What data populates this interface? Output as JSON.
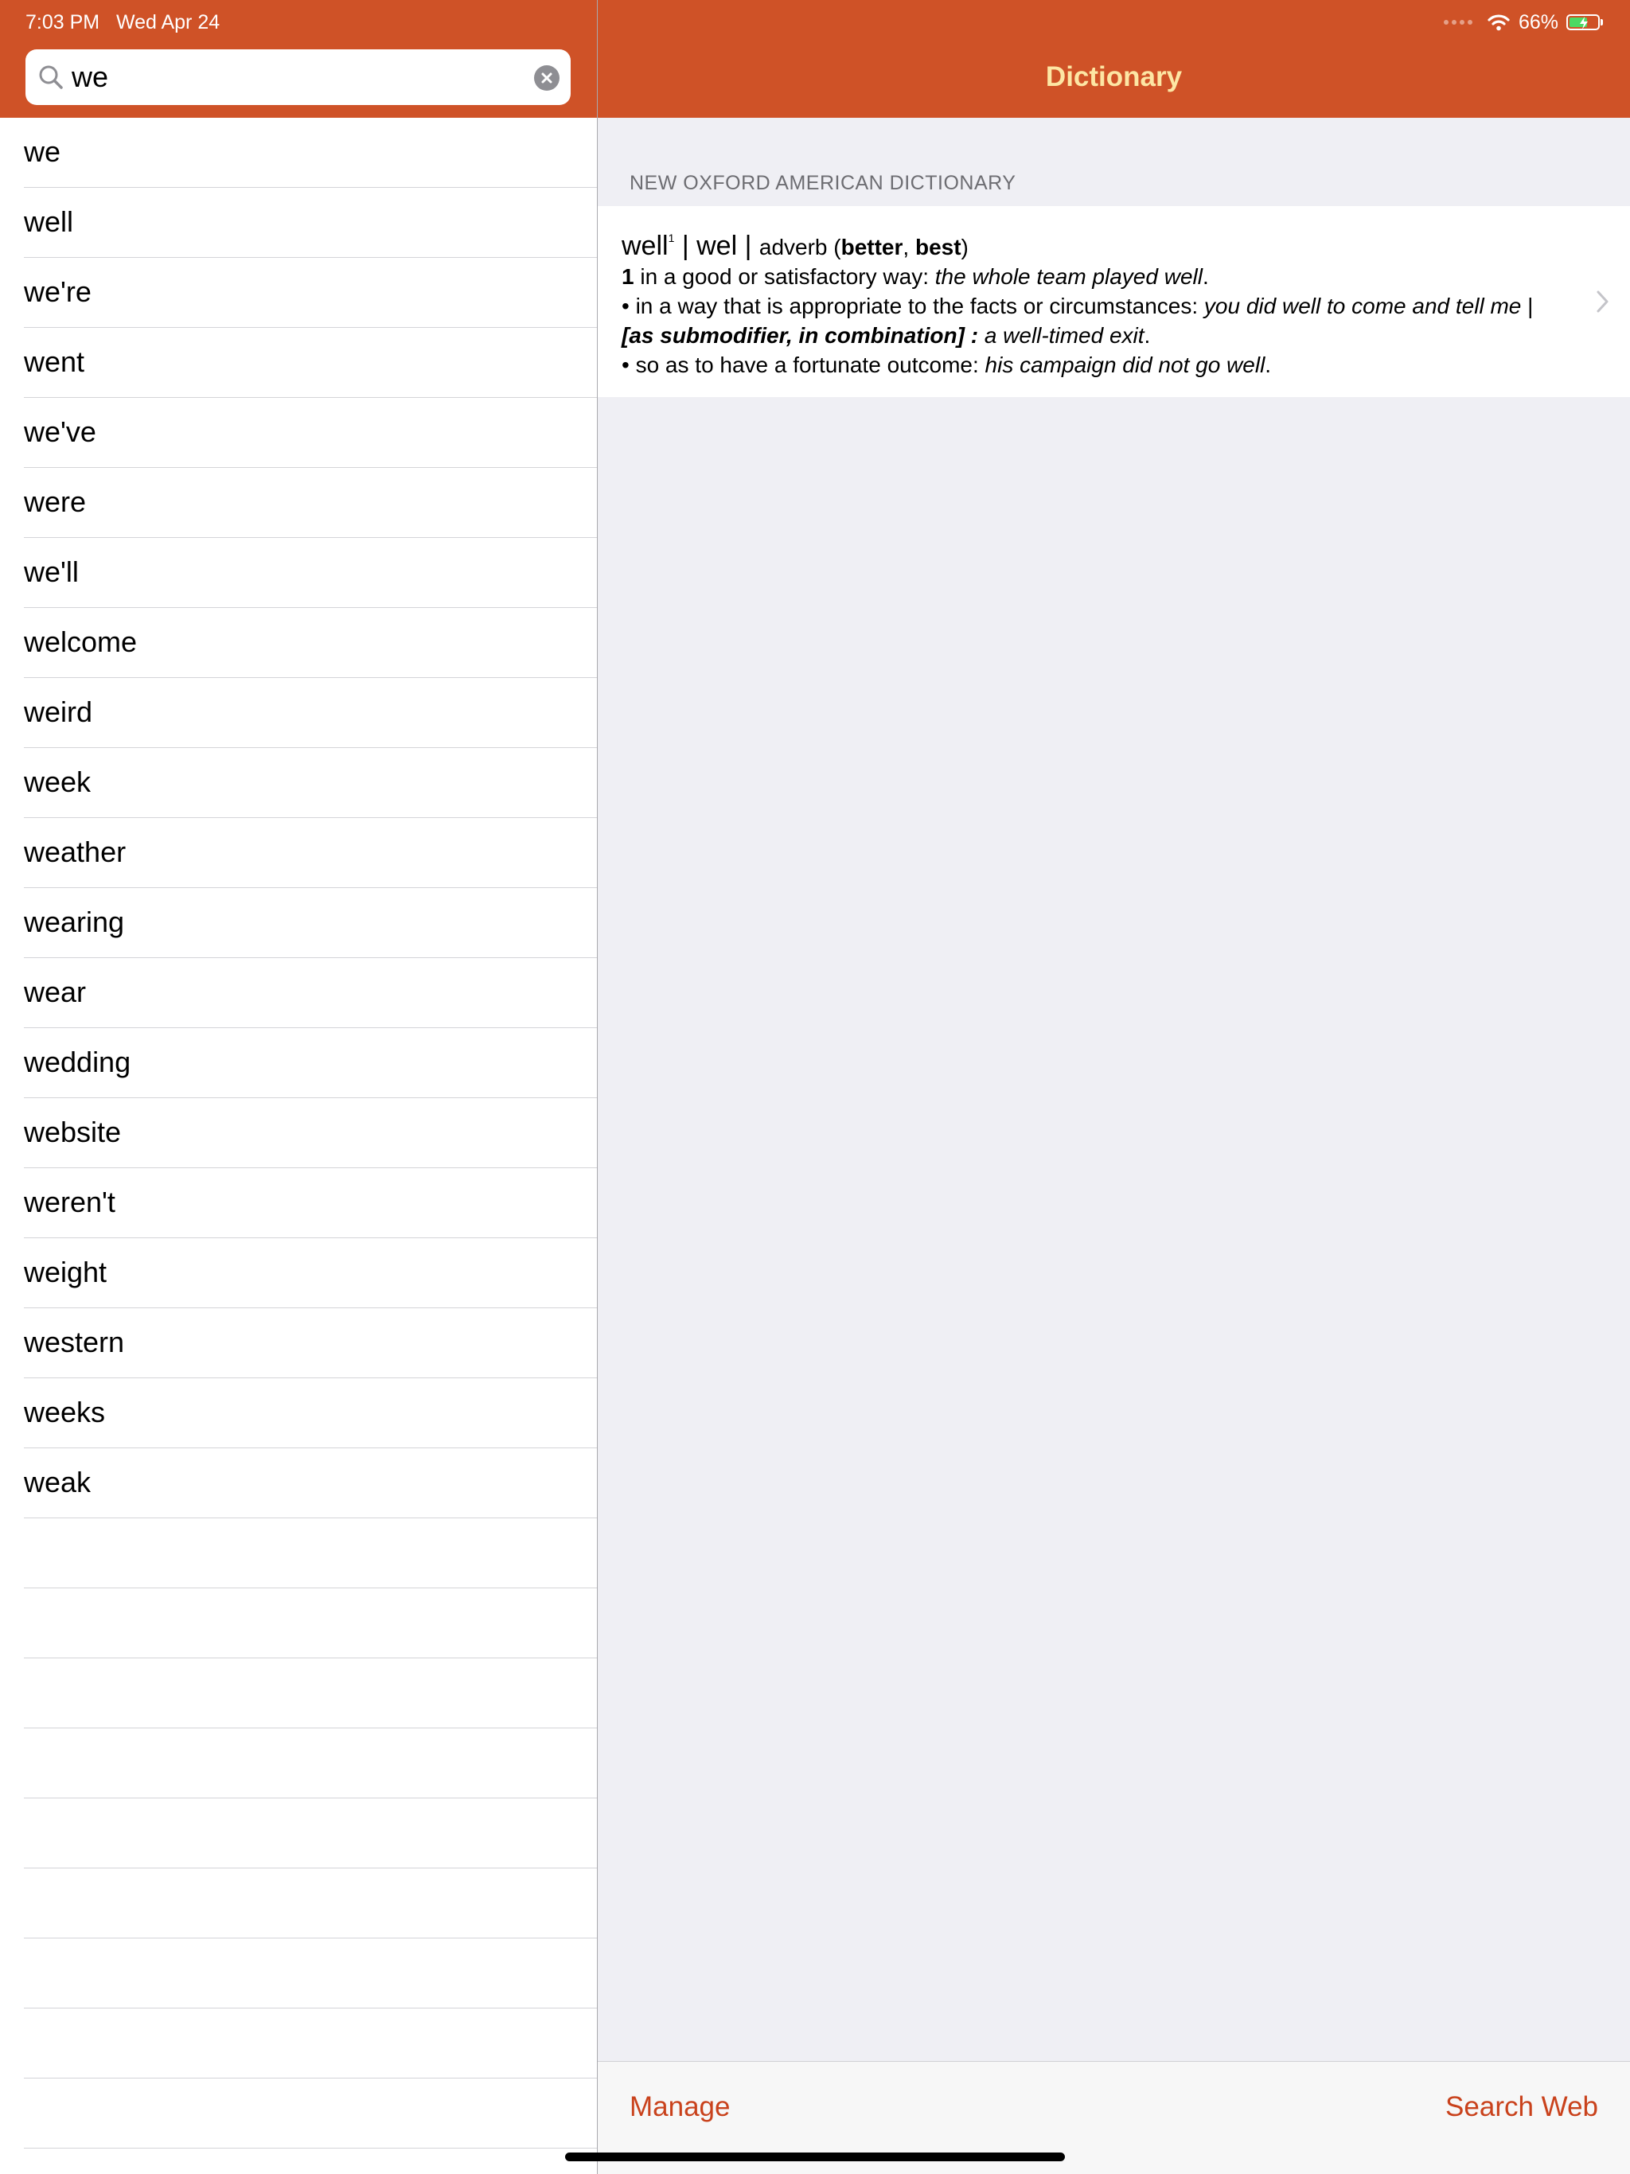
{
  "status_bar": {
    "time": "7:03 PM",
    "date": "Wed Apr 24",
    "battery_percent": "66%",
    "battery_level": 0.66,
    "icons": [
      "cellular-signal-icon",
      "wifi-icon",
      "battery-charging-icon"
    ]
  },
  "search": {
    "value": "we",
    "icon": "search-icon",
    "clear_icon": "clear-icon"
  },
  "results": [
    "we",
    "well",
    "we're",
    "went",
    "we've",
    "were",
    "we'll",
    "welcome",
    "weird",
    "week",
    "weather",
    "wearing",
    "wear",
    "wedding",
    "website",
    "weren't",
    "weight",
    "western",
    "weeks",
    "weak"
  ],
  "detail": {
    "title": "Dictionary",
    "section_header": "NEW OXFORD AMERICAN DICTIONARY",
    "entry": {
      "headword": "well",
      "homograph": "1",
      "sep1": " | ",
      "pronunciation": "wel",
      "sep2": " | ",
      "part_of_speech": "adverb",
      "paren_open": " (",
      "comparative": "better",
      "comma": ", ",
      "superlative": "best",
      "paren_close": ")",
      "sense1": {
        "number": "1",
        "definition": " in a good or satisfactory way: ",
        "example": "the whole team played well",
        "end": "."
      },
      "sense2": {
        "bullet": "• in a way that is appropriate to the facts or circumstances: ",
        "example": "you did well to come and tell me",
        "sep": " | ",
        "note": "[as submodifier, in combination] : ",
        "example2": "a well-timed exit",
        "end": "."
      },
      "sense3": {
        "bullet": "• so as to have a fortunate outcome: ",
        "example": "his campaign did not go well",
        "end": "."
      }
    }
  },
  "toolbar": {
    "manage_label": "Manage",
    "search_web_label": "Search Web"
  },
  "colors": {
    "nav_bar": "#cf5227",
    "nav_title": "#fde6a4",
    "accent": "#c9421c",
    "background": "#efeff4"
  }
}
